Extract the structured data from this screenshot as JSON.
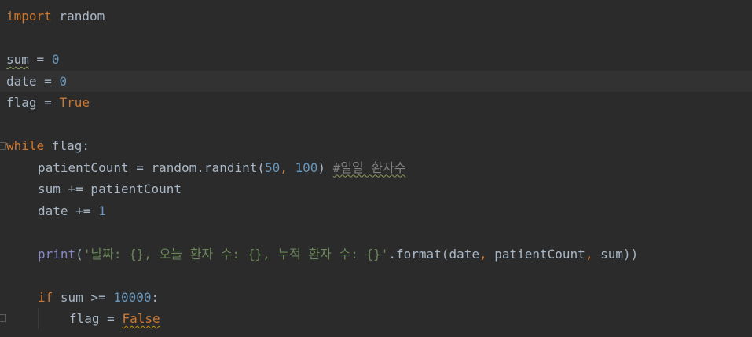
{
  "code": {
    "l1": {
      "kw": "import",
      "rest": " random"
    },
    "l3": {
      "var": "sum",
      "op": " = ",
      "num": "0"
    },
    "l4": {
      "var": "date",
      "op": " = ",
      "num": "0"
    },
    "l5": {
      "var": "flag",
      "op": " = ",
      "val": "True"
    },
    "l7": {
      "kw": "while",
      "rest": " flag:"
    },
    "l8": {
      "a": "patientCount = random.randint(",
      "n1": "50",
      "comma": ", ",
      "n2": "100",
      "close": ")",
      "sp": " ",
      "comment": "#일일 환자수"
    },
    "l9": {
      "text": "sum += patientCount"
    },
    "l10": {
      "a": "date += ",
      "num": "1"
    },
    "l12": {
      "fn": "print",
      "open": "(",
      "str": "'날짜: {}, 오늘 환자 수: {}, 누적 환자 수: {}'",
      "method": ".format(date",
      "c1": ", ",
      "arg2": "patientCount",
      "c2": ", ",
      "arg3": "sum))"
    },
    "l14": {
      "kw": "if",
      "mid": " sum >= ",
      "num": "10000",
      "colon": ":"
    },
    "l15": {
      "var": "flag",
      "op": " = ",
      "val": "False"
    }
  },
  "colors": {
    "background": "#2b2b2b",
    "current_line": "#323232",
    "keyword": "#cc7832",
    "number": "#6897bb",
    "string": "#6a8759",
    "comment": "#808080",
    "identifier": "#a9b7c6"
  }
}
